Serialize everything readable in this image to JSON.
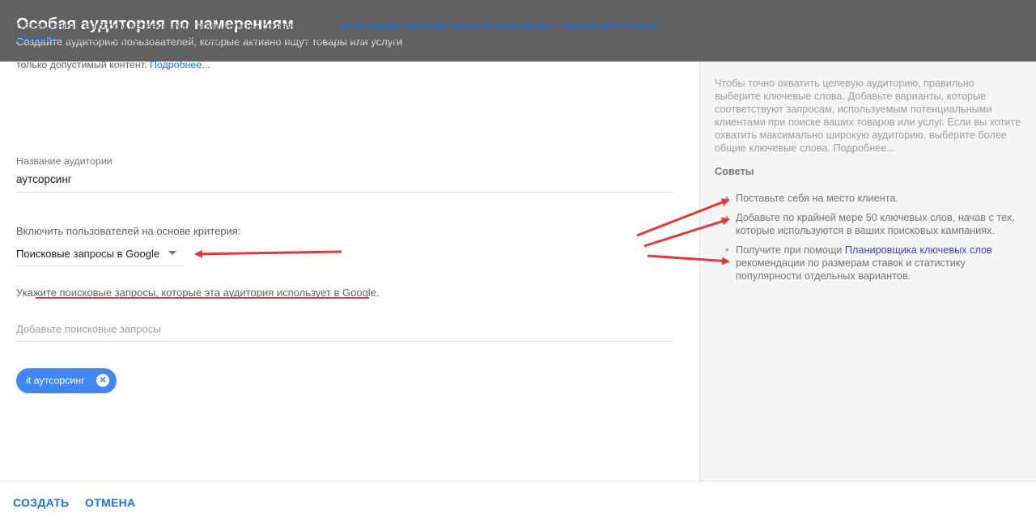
{
  "header": {
    "title": "Особая аудитория по намерениям",
    "subtitle": "Создайте аудиторию пользователей, которые активно ищут товары или услуги"
  },
  "intro": {
    "part1": "Объявления с выбором целевой аудитории должны соответствовать ",
    "policy_link": "правилам размещения персонализированных объявлений в Google Рекламе",
    "part2": ". Деликатные ключевые слова будут использоваться для показа рекламы только на страницах соответствующей тематики или не будут использоваться вообще. Все кампании должны соответствовать правилам размещения объявлений в Google Рекламе и содержать только допустимый контент. ",
    "more_link": "Подробнее..."
  },
  "audience_name": {
    "label": "Название аудитории",
    "value": "аутсорсинг"
  },
  "criteria": {
    "label": "Включить пользователей на основе критерия:",
    "selected": "Поисковые запросы в Google"
  },
  "queries": {
    "hint": "Укажите поисковые запросы, которые эта аудитория использует в Google.",
    "placeholder": "Добавьте поисковые запросы",
    "chips": [
      "it аутсорсинг"
    ]
  },
  "sidebar": {
    "text": "Чтобы точно охватить целевую аудиторию, правильно выберите ключевые слова. Добавьте варианты, которые соответствуют запросам, используемым потенциальными клиентами при поиске ваших товаров или услуг. Если вы хотите охватить максимально широкую аудиторию, выберите более общие ключевые слова. Подробнее...",
    "tips_title": "Советы",
    "tip1": "Поставьте себя на место клиента.",
    "tip2": "Добавьте по крайней мере 50 ключевых слов, начав с тех, которые используются в ваших поисковых кампаниях.",
    "tip3_before": "Получите при помощи ",
    "tip3_link": "Планировщика ключевых слов",
    "tip3_after": " рекомендации по размерам ставок и статистику популярности отдельных вариантов."
  },
  "footer": {
    "create_label": "СОЗДАТЬ",
    "cancel_label": "ОТМЕНА"
  },
  "colors": {
    "header_bg": "#616161",
    "link": "#1a73e8",
    "chip_bg": "#4285f4",
    "annotation": "#e53935"
  }
}
